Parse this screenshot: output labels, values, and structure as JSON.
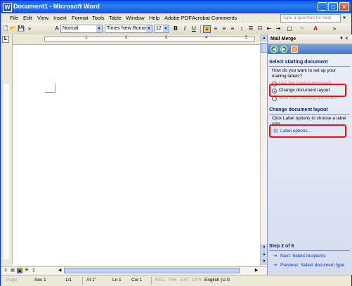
{
  "window": {
    "title": "Document1 - Microsoft Word",
    "app_icon_letter": "W"
  },
  "menu": [
    "File",
    "Edit",
    "View",
    "Insert",
    "Format",
    "Tools",
    "Table",
    "Window",
    "Help",
    "Adobe PDF",
    "Acrobat Comments"
  ],
  "help_placeholder": "Type a question for help",
  "toolbar": {
    "style": "Normal",
    "font": "Times New Roman",
    "size": "12"
  },
  "ruler_numbers": [
    "1",
    "2",
    "3",
    "4",
    "5"
  ],
  "task_pane": {
    "title": "Mail Merge",
    "section1_title": "Select starting document",
    "section1_prompt": "How do you want to set up your mailing labels?",
    "option_use_current": "Use the current document",
    "option_change_layout": "Change document layout",
    "option_existing": "Start from existing document",
    "section2_title": "Change document layout",
    "section2_text": "Click Label options to choose a label size.",
    "label_options_link": "Label options...",
    "step": "Step 2 of 6",
    "next_link": "Next: Select recipients",
    "prev_link": "Previous: Select document type"
  },
  "status": {
    "page": "Page",
    "sec": "Sec 1",
    "page_of": "1/1",
    "at": "At 1\"",
    "ln": "Ln 1",
    "col": "Col 1",
    "rec": "REC",
    "trk": "TRK",
    "ext": "EXT",
    "ovr": "OVR",
    "language": "English (U.S"
  },
  "colors": {
    "highlight": "#ee1111",
    "titlebar": "#0a5ee8",
    "link": "#0033cc"
  }
}
